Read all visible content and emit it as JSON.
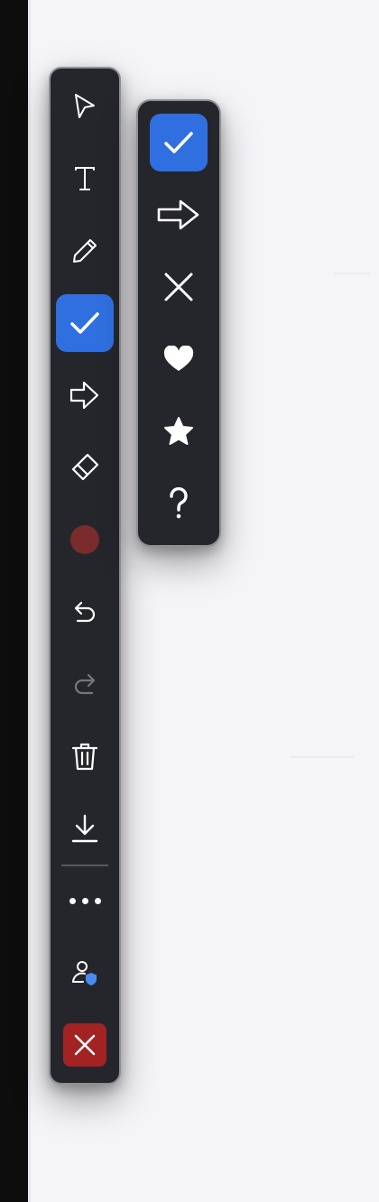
{
  "toolbar": {
    "tools": [
      {
        "name": "select-tool",
        "icon": "cursor-arrow-icon"
      },
      {
        "name": "text-tool",
        "icon": "text-t-icon"
      },
      {
        "name": "pen-tool",
        "icon": "pencil-icon"
      },
      {
        "name": "stamp-tool",
        "icon": "checkmark-icon",
        "active": true
      },
      {
        "name": "arrow-tool",
        "icon": "arrow-right-icon"
      },
      {
        "name": "eraser-tool",
        "icon": "eraser-icon"
      },
      {
        "name": "color-picker",
        "icon": "color-dot",
        "color": "#7a2b2b"
      },
      {
        "name": "undo-button",
        "icon": "undo-icon"
      },
      {
        "name": "redo-button",
        "icon": "redo-icon",
        "disabled": true
      },
      {
        "name": "delete-button",
        "icon": "trash-icon"
      },
      {
        "name": "download-button",
        "icon": "download-icon"
      },
      {
        "name": "more-button",
        "icon": "more-dots-icon"
      },
      {
        "name": "privacy-button",
        "icon": "user-shield-icon"
      },
      {
        "name": "close-button",
        "icon": "close-x-icon",
        "color": "#a32222"
      }
    ]
  },
  "stamp_menu": {
    "options": [
      {
        "name": "stamp-check",
        "icon": "checkmark-icon",
        "selected": true
      },
      {
        "name": "stamp-arrow",
        "icon": "arrow-right-icon"
      },
      {
        "name": "stamp-cross",
        "icon": "x-icon"
      },
      {
        "name": "stamp-heart",
        "icon": "heart-icon"
      },
      {
        "name": "stamp-star",
        "icon": "star-icon"
      },
      {
        "name": "stamp-question",
        "icon": "question-mark-icon"
      }
    ]
  },
  "colors": {
    "accent": "#2f6fe0",
    "panel": "#25262c",
    "close": "#a32222",
    "shield": "#4b8af0"
  }
}
